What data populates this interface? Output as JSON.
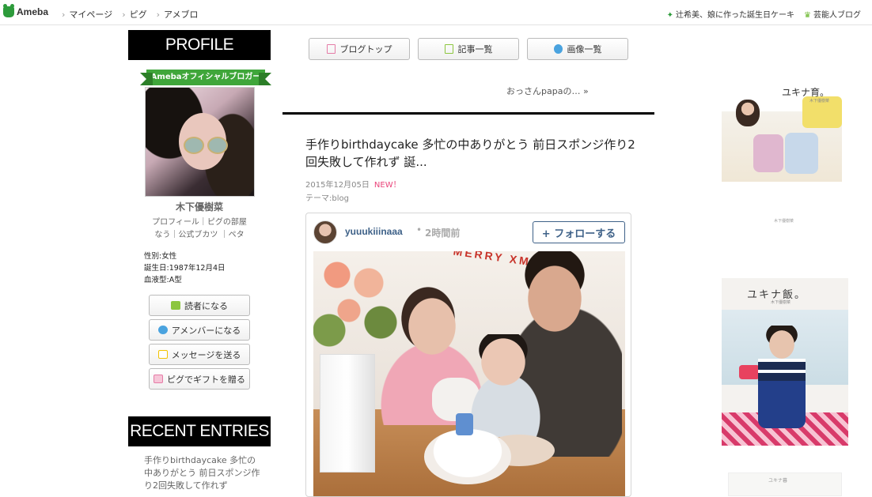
{
  "topbar": {
    "logo": "Ameba",
    "nav": [
      "マイページ",
      "ピグ",
      "アメブロ"
    ],
    "right_links": [
      {
        "icon": "star-icon",
        "label": "辻希美、娘に作った誕生日ケーキ"
      },
      {
        "icon": "crown-icon",
        "label": "芸能人ブログ"
      }
    ]
  },
  "sidebar": {
    "profile_heading": "PROFILE",
    "ribbon": "Amebaオフィシャルブロガー",
    "name": "木下優樹菜",
    "links_line1": "プロフィール｜ピグの部屋",
    "links_line2": "なう｜公式ブカツ ｜ペタ",
    "info": [
      "性別:女性",
      "誕生日:1987年12月4日",
      "血液型:A型"
    ],
    "buttons": [
      {
        "label": "読者になる",
        "icon": "book-icon",
        "color": "#8cc63f"
      },
      {
        "label": "アメンバーになる",
        "icon": "chat-icon",
        "color": "#4aa3df"
      },
      {
        "label": "メッセージを送る",
        "icon": "mail-icon",
        "color": "#f2c200"
      },
      {
        "label": "ピグでギフトを贈る",
        "icon": "gift-icon",
        "color": "#e57ba6"
      }
    ],
    "recent_heading": "RECENT ENTRIES",
    "recent_entry": "手作りbirthdaycake 多忙の中ありがとう 前日スポンジ作り2回失敗して作れず"
  },
  "main": {
    "tabs": [
      {
        "label": "ブログトップ",
        "icon": "document-icon",
        "color": "#e57ba6"
      },
      {
        "label": "記事一覧",
        "icon": "list-icon",
        "color": "#8cc63f"
      },
      {
        "label": "画像一覧",
        "icon": "camera-icon",
        "color": "#4aa3df"
      }
    ],
    "prev_link": "おっさんpapaの… »",
    "post": {
      "title": "手作りbirthdaycake 多忙の中ありがとう 前日スポンジ作り2回失敗して作れず 誕...",
      "date": "2015年12月05日",
      "new_badge": "NEW！",
      "theme": "テーマ:blog"
    },
    "instagram": {
      "username": "yuuukiiinaaa",
      "separator": "•",
      "time": "2時間前",
      "follow": "+ フォローする",
      "banner": "MERRY  XMAS"
    }
  },
  "ads": {
    "ad1_title": "ユキナ育。",
    "ad1_sub": "木下優樹菜",
    "ad1_mid": "木下優樹菜",
    "ad2_title": "ユキナ飯。",
    "ad2_sub": "木下優樹菜",
    "ad3_title": "ユキナ暮"
  }
}
